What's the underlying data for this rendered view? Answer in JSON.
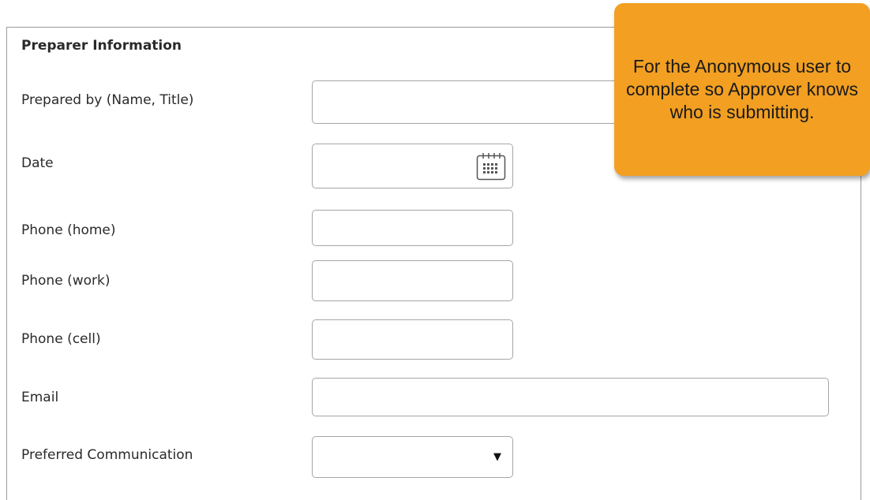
{
  "section": {
    "title": "Preparer Information"
  },
  "fields": {
    "prepared_by": {
      "label": "Prepared by (Name, Title)",
      "value": ""
    },
    "date": {
      "label": "Date",
      "value": ""
    },
    "phone_home": {
      "label": "Phone (home)",
      "value": ""
    },
    "phone_work": {
      "label": "Phone (work)",
      "value": ""
    },
    "phone_cell": {
      "label": "Phone (cell)",
      "value": ""
    },
    "email": {
      "label": "Email",
      "value": ""
    },
    "preferred_communication": {
      "label": "Preferred Communication",
      "selected": "",
      "arrow": "▼"
    }
  },
  "callout": {
    "text": "For the Anonymous user to complete so Approver knows who is submitting.",
    "color": "#f29f22"
  },
  "icons": {
    "date": "calendar-icon",
    "dropdown": "chevron-down-icon"
  }
}
